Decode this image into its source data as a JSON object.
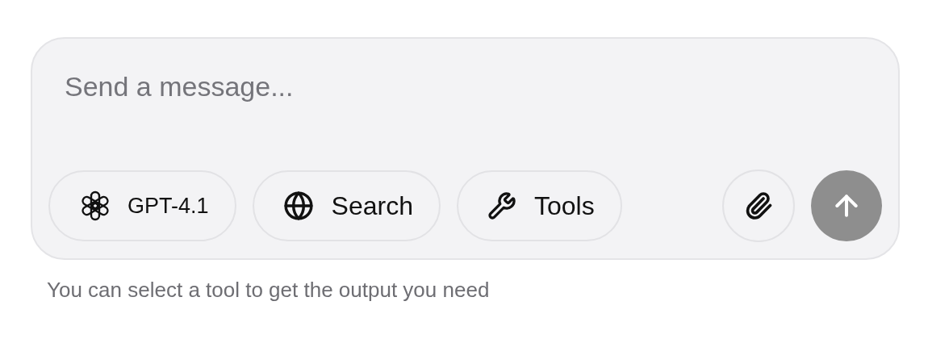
{
  "composer": {
    "placeholder": "Send a message...",
    "chips": [
      {
        "kind": "model",
        "label": "GPT-4.1"
      },
      {
        "kind": "search",
        "label": "Search"
      },
      {
        "kind": "tools",
        "label": "Tools"
      }
    ],
    "send_disabled": true
  },
  "hint": "You can select a tool to get the output you need"
}
